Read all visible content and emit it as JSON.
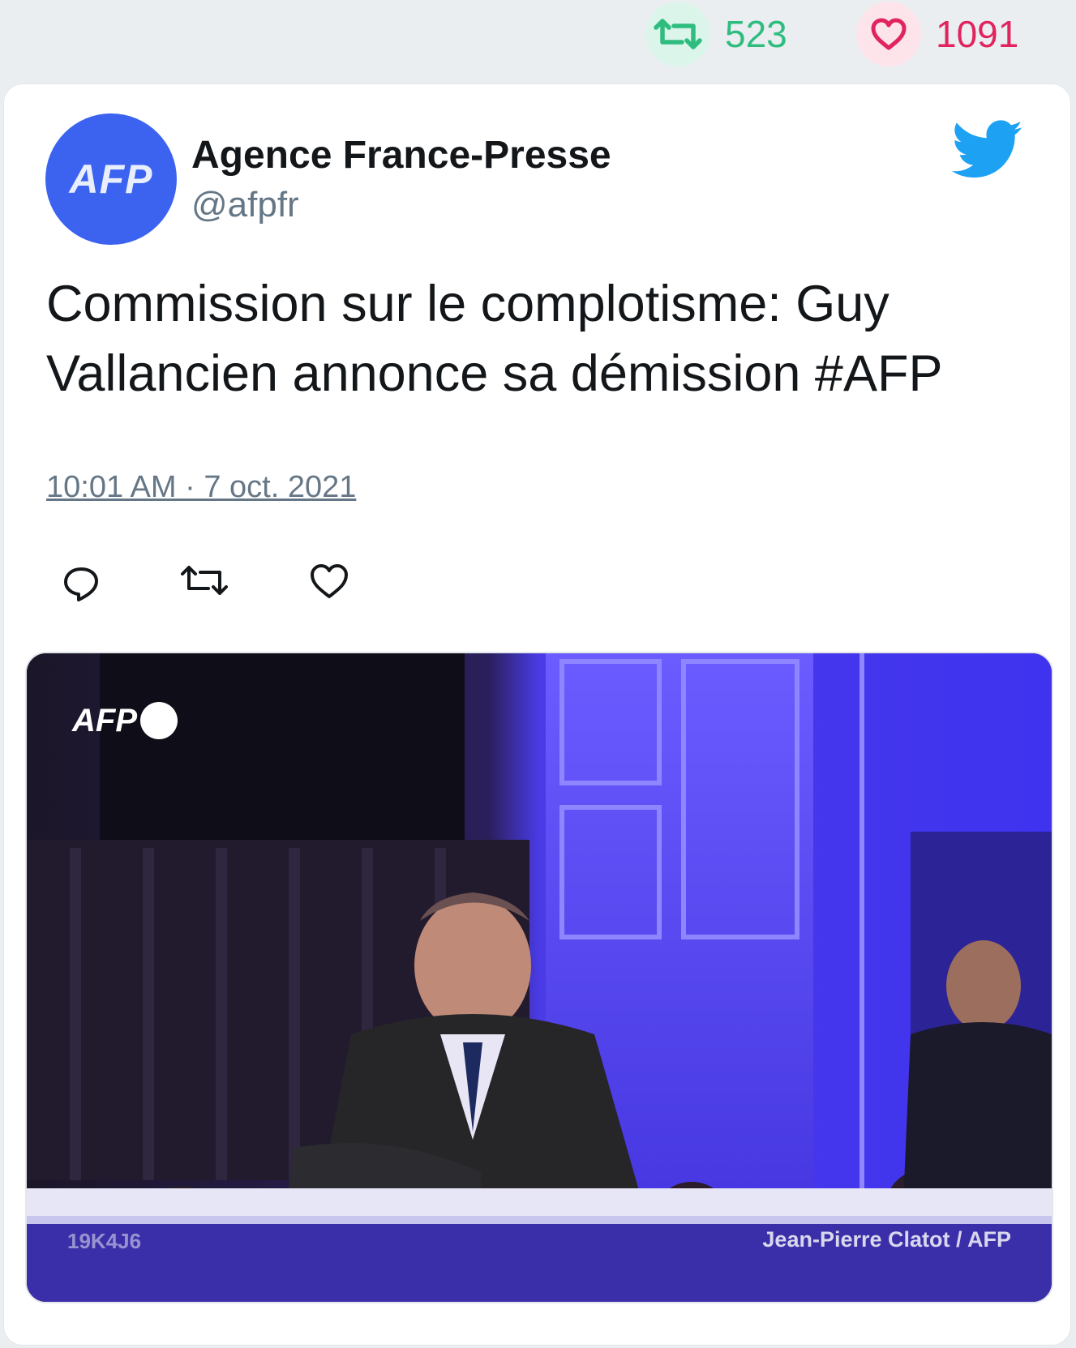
{
  "stats": {
    "retweets": "523",
    "likes": "1091",
    "retweet_color": "#2fbd7f",
    "like_color": "#e0245e",
    "retweet_icon": "retweet-icon",
    "like_icon": "heart-icon"
  },
  "tweet": {
    "avatar_text": "AFP",
    "author_name": "Agence France-Presse",
    "handle": "@afpfr",
    "text": "Commission sur le complotisme: Guy Vallancien annonce sa démission #AFP",
    "timestamp": "10:01 AM · 7 oct. 2021",
    "brand_icon": "twitter-bird-icon",
    "accent_color": "#1da1f2"
  },
  "actions": [
    {
      "icon": "reply-icon"
    },
    {
      "icon": "retweet-icon"
    },
    {
      "icon": "heart-icon"
    }
  ],
  "media": {
    "watermark_logo": "AFP",
    "photo_code": "19K4J6",
    "credit": "Jean-Pierre Clatot / AFP"
  }
}
